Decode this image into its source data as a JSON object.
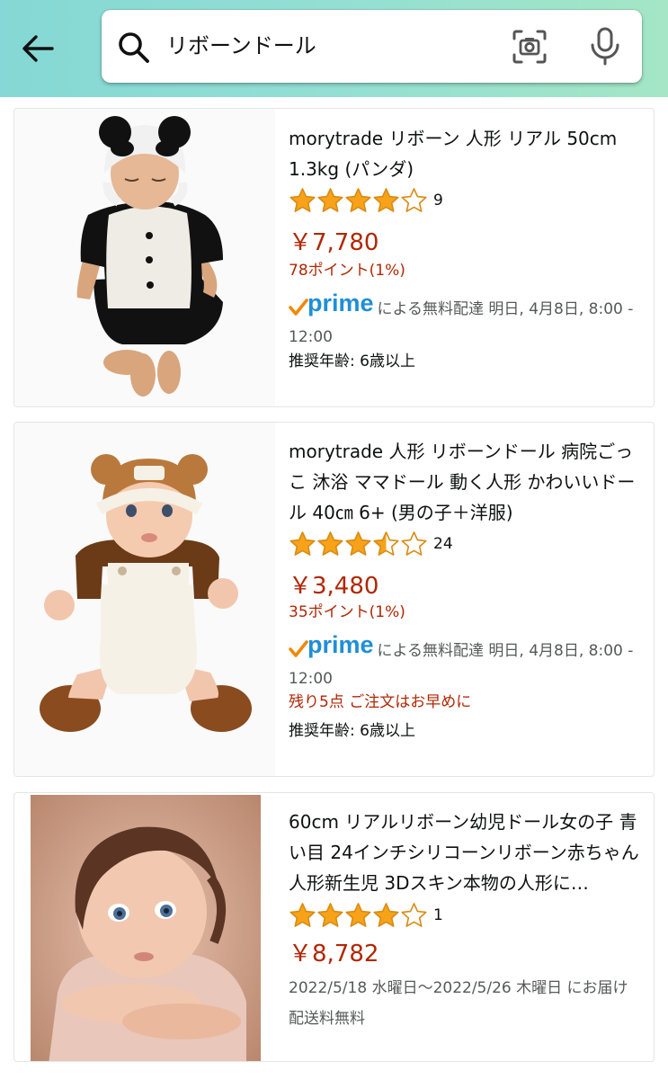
{
  "search": {
    "query": "リボーンドール"
  },
  "colors": {
    "price": "#b12704",
    "prime": "#1f8fd6",
    "star": "#f7a218",
    "header_start": "#85d8d5",
    "header_end": "#a4e6c6"
  },
  "icons": [
    "back-arrow-icon",
    "search-icon",
    "camera-icon",
    "mic-icon",
    "star-icon",
    "prime-check-icon"
  ],
  "products": [
    {
      "title": "morytrade リボーン 人形 リアル 50cm 1.3kg (パンダ)",
      "rating": 4.0,
      "review_count": "9",
      "price": "￥7,780",
      "points": "78ポイント(1%)",
      "prime": "prime",
      "delivery": "による無料配達 明日, 4月8日, 8:00 - 12:00",
      "age": "推奨年齢: 6歳以上"
    },
    {
      "title": "morytrade 人形 リボーンドール 病院ごっこ 沐浴 ママドール 動く人形 かわいいドール 40㎝ 6+ (男の子＋洋服)",
      "rating": 3.5,
      "review_count": "24",
      "price": "￥3,480",
      "points": "35ポイント(1%)",
      "prime": "prime",
      "delivery": "による無料配達 明日, 4月8日, 8:00 - 12:00",
      "stock": "残り5点 ご注文はお早めに",
      "age": "推奨年齢: 6歳以上"
    },
    {
      "title": "60cm リアルリボーン幼児ドール女の子 青い目 24インチシリコーンリボーン赤ちゃん人形新生児 3Dスキン本物の人形に…",
      "rating": 4.0,
      "review_count": "1",
      "price": "￥8,782",
      "delivery": "2022/5/18 水曜日～2022/5/26 木曜日 にお届け",
      "shipping": "配送料無料"
    }
  ]
}
